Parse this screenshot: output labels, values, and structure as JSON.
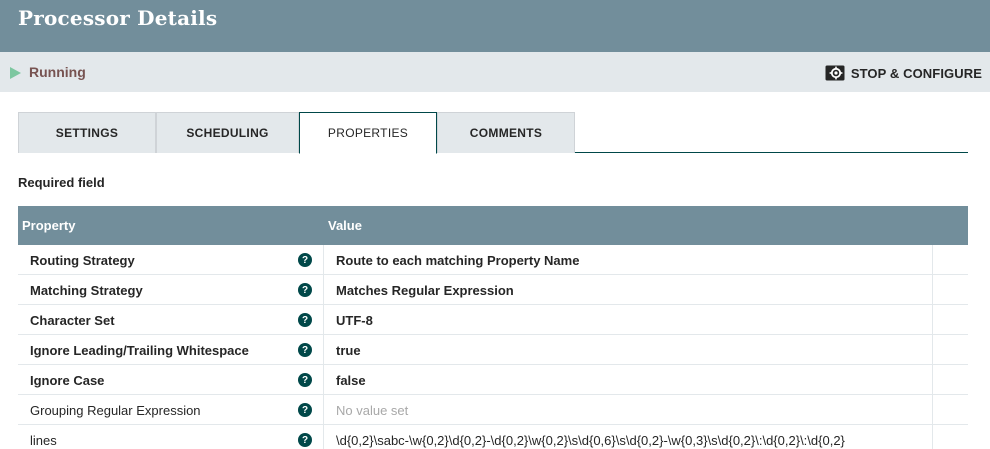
{
  "header": {
    "title": "Processor Details"
  },
  "status": {
    "state": "Running",
    "action_label": "STOP & CONFIGURE"
  },
  "tabs": [
    {
      "label": "SETTINGS"
    },
    {
      "label": "SCHEDULING"
    },
    {
      "label": "PROPERTIES"
    },
    {
      "label": "COMMENTS"
    }
  ],
  "active_tab": "PROPERTIES",
  "required_label": "Required field",
  "table": {
    "columns": [
      "Property",
      "Value"
    ],
    "rows": [
      {
        "property": "Routing Strategy",
        "value": "Route to each matching Property Name",
        "required": true
      },
      {
        "property": "Matching Strategy",
        "value": "Matches Regular Expression",
        "required": true
      },
      {
        "property": "Character Set",
        "value": "UTF-8",
        "required": true
      },
      {
        "property": "Ignore Leading/Trailing Whitespace",
        "value": "true",
        "required": true
      },
      {
        "property": "Ignore Case",
        "value": "false",
        "required": true
      },
      {
        "property": "Grouping Regular Expression",
        "value": "No value set",
        "required": false,
        "unset": true
      },
      {
        "property": "lines",
        "value": "\\d{0,2}\\sabc-\\w{0,2}\\d{0,2}-\\d{0,2}\\w{0,2}\\s\\d{0,6}\\s\\d{0,2}-\\w{0,3}\\s\\d{0,2}\\:\\d{0,2}\\:\\d{0,2}",
        "required": false
      }
    ]
  },
  "colors": {
    "header_bg": "#728e9b",
    "status_bg": "#e3e8eb",
    "running": "#7dc7a0",
    "accent": "#004849"
  }
}
